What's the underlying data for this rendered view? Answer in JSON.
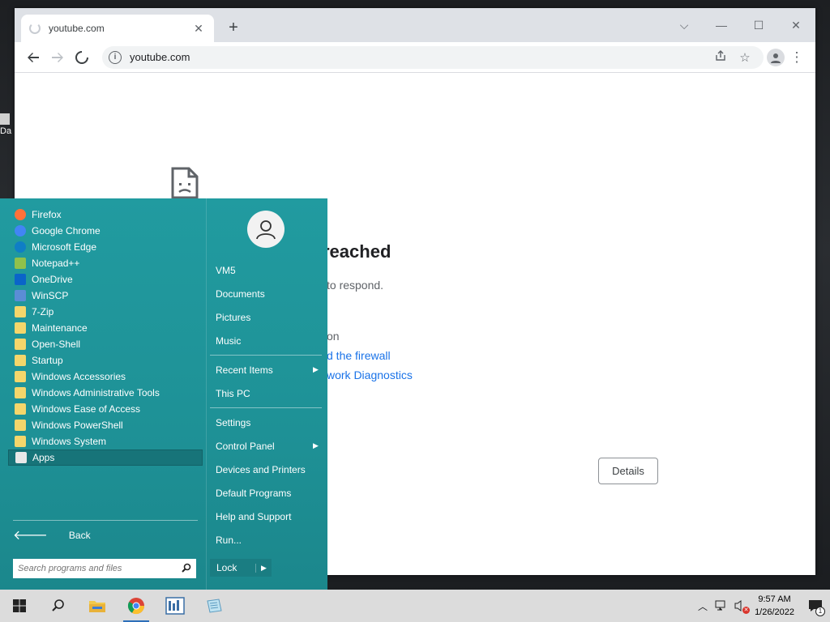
{
  "browser": {
    "tab_title": "youtube.com",
    "tab_close": "✕",
    "new_tab": "+",
    "url": "youtube.com",
    "window_controls": [
      "⌵",
      "—",
      "☐",
      "✕"
    ]
  },
  "error_page": {
    "heading": "reached",
    "line1": "to respond.",
    "line2": "on",
    "link1": "d the firewall",
    "link2": "work Diagnostics",
    "details_button": "Details"
  },
  "start_menu": {
    "programs": [
      {
        "label": "Firefox",
        "icon": "firefox-icon",
        "color": "#ff7139"
      },
      {
        "label": "Google Chrome",
        "icon": "chrome-icon",
        "color": "#4285f4"
      },
      {
        "label": "Microsoft Edge",
        "icon": "edge-icon",
        "color": "#0f7ec6"
      },
      {
        "label": "Notepad++",
        "icon": "notepadpp-icon",
        "color": "#90c14b"
      },
      {
        "label": "OneDrive",
        "icon": "onedrive-icon",
        "color": "#0a64c9"
      },
      {
        "label": "WinSCP",
        "icon": "winscp-icon",
        "color": "#5b8dd6"
      },
      {
        "label": "7-Zip",
        "icon": "folder-icon",
        "color": "#f4d66b"
      },
      {
        "label": "Maintenance",
        "icon": "folder-icon",
        "color": "#f4d66b"
      },
      {
        "label": "Open-Shell",
        "icon": "folder-icon",
        "color": "#f4d66b"
      },
      {
        "label": "Startup",
        "icon": "folder-icon",
        "color": "#f4d66b"
      },
      {
        "label": "Windows Accessories",
        "icon": "folder-icon",
        "color": "#f4d66b"
      },
      {
        "label": "Windows Administrative Tools",
        "icon": "folder-icon",
        "color": "#f4d66b"
      },
      {
        "label": "Windows Ease of Access",
        "icon": "folder-icon",
        "color": "#f4d66b"
      },
      {
        "label": "Windows PowerShell",
        "icon": "folder-icon",
        "color": "#f4d66b"
      },
      {
        "label": "Windows System",
        "icon": "folder-icon",
        "color": "#f4d66b"
      },
      {
        "label": "Apps",
        "icon": "apps-icon",
        "color": "#e8e8e8"
      }
    ],
    "back_label": "Back",
    "search_placeholder": "Search programs and files",
    "right_items": {
      "user": "VM5",
      "documents": "Documents",
      "pictures": "Pictures",
      "music": "Music",
      "recent": "Recent Items",
      "thispc": "This PC",
      "settings": "Settings",
      "control_panel": "Control Panel",
      "devices": "Devices and Printers",
      "default_programs": "Default Programs",
      "help": "Help and Support",
      "run": "Run..."
    },
    "lock_label": "Lock"
  },
  "taskbar": {
    "time": "9:57 AM",
    "date": "1/26/2022",
    "notification_count": "1"
  },
  "desktop": {
    "fragment_label": "Da"
  }
}
